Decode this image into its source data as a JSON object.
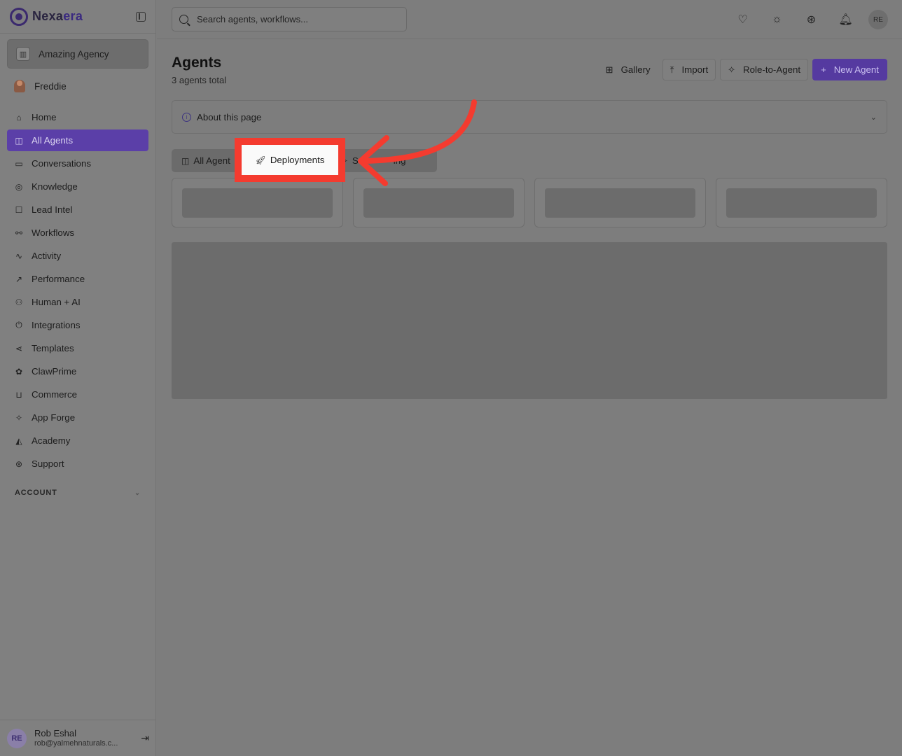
{
  "brand": {
    "name_prefix": "Nexa",
    "name_suffix": "era"
  },
  "sidebar": {
    "agency": "Amazing Agency",
    "user": "Freddie",
    "items": [
      {
        "label": "Home",
        "icon": "home-icon",
        "glyph": "⌂"
      },
      {
        "label": "All Agents",
        "icon": "bot-icon",
        "glyph": "◫"
      },
      {
        "label": "Conversations",
        "icon": "chat-icon",
        "glyph": "▭"
      },
      {
        "label": "Knowledge",
        "icon": "brain-icon",
        "glyph": "◎"
      },
      {
        "label": "Lead Intel",
        "icon": "contact-icon",
        "glyph": "☐"
      },
      {
        "label": "Workflows",
        "icon": "workflow-icon",
        "glyph": "⚯"
      },
      {
        "label": "Activity",
        "icon": "activity-icon",
        "glyph": "∿"
      },
      {
        "label": "Performance",
        "icon": "trending-icon",
        "glyph": "↗"
      },
      {
        "label": "Human + AI",
        "icon": "network-icon",
        "glyph": "⚇"
      },
      {
        "label": "Integrations",
        "icon": "plug-icon",
        "glyph": "⏻"
      },
      {
        "label": "Templates",
        "icon": "share-icon",
        "glyph": "⋖"
      },
      {
        "label": "ClawPrime",
        "icon": "paw-icon",
        "glyph": "✿"
      },
      {
        "label": "Commerce",
        "icon": "cart-icon",
        "glyph": "⊔"
      },
      {
        "label": "App Forge",
        "icon": "sparkles-icon",
        "glyph": "✧"
      },
      {
        "label": "Academy",
        "icon": "graduation-cap-icon",
        "glyph": "◭"
      },
      {
        "label": "Support",
        "icon": "lifebuoy-icon",
        "glyph": "⊛"
      }
    ],
    "active_index": 1,
    "account_label": "ACCOUNT",
    "footer": {
      "initials": "RE",
      "name": "Rob Eshal",
      "email": "rob@yalmehnaturals.c..."
    }
  },
  "topbar": {
    "search_placeholder": "Search agents, workflows...",
    "avatar_initials": "RE"
  },
  "page": {
    "title": "Agents",
    "subtitle": "3 agents total",
    "actions": {
      "gallery": "Gallery",
      "import": "Import",
      "role_to_agent": "Role-to-Agent",
      "new_agent": "New Agent"
    },
    "about": "About this page",
    "tabs": {
      "all_agents": "All Agent",
      "deployments": "Deployments",
      "third_prefix": "S",
      "third_suffix": "ing"
    }
  },
  "colors": {
    "accent": "#553aa0",
    "highlight": "#f43b2f"
  }
}
